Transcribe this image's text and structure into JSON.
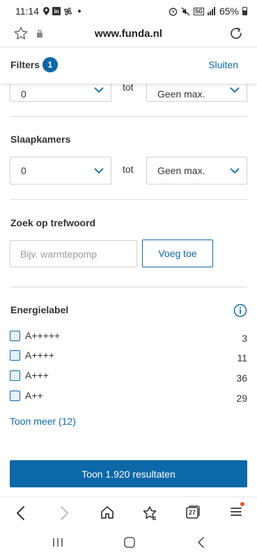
{
  "status_bar": {
    "time": "11:14",
    "battery": "65%",
    "network": "5G"
  },
  "browser": {
    "url": "www.funda.nl",
    "tab_count": "27",
    "icons": [
      "star-icon",
      "lock-icon",
      "reload-icon",
      "back-icon",
      "forward-icon",
      "home-icon",
      "bookmarks-icon",
      "tabs-icon",
      "menu-icon"
    ]
  },
  "filters": {
    "title": "Filters",
    "badge_count": "1",
    "close_label": "Sluiten"
  },
  "range_top": {
    "min_value": "0",
    "separator": "tot",
    "max_value": "Geen max."
  },
  "bedrooms": {
    "title": "Slaapkamers",
    "min_value": "0",
    "separator": "tot",
    "max_value": "Geen max."
  },
  "keyword": {
    "title": "Zoek op trefwoord",
    "placeholder": "Bijv. warmtepomp",
    "value": "",
    "add_label": "Voeg toe"
  },
  "energy": {
    "title": "Energielabel",
    "items": [
      {
        "label": "A+++++",
        "count": "3"
      },
      {
        "label": "A++++",
        "count": "11"
      },
      {
        "label": "A+++",
        "count": "36"
      },
      {
        "label": "A++",
        "count": "29"
      }
    ],
    "more_label": "Toon meer (12)"
  },
  "results_button": "Toon 1.920 resultaten",
  "colors": {
    "accent": "#0c68a8",
    "notification_dot": "#e8541e",
    "divider": "#dadada"
  }
}
